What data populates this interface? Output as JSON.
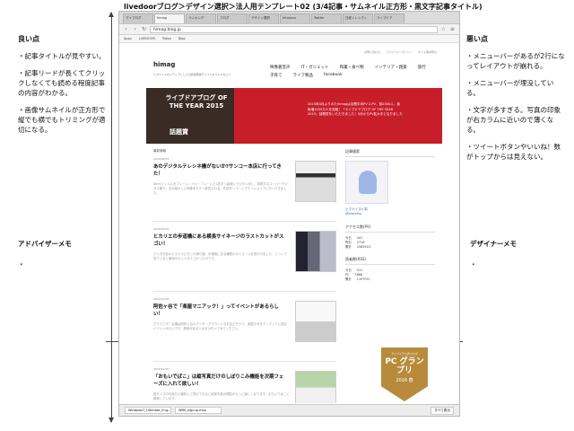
{
  "page_title": "livedoorブログ＞デザイン選択＞法人用テンプレート02 (3/4記事・サムネイル正方形・黒文字記事タイトル)",
  "left_notes": {
    "heading": "良い点",
    "items": [
      "・記事タイトルが見やすい。",
      "・記事リードが長くてクリックしなくても読める程度記事の内容がわかる。",
      "・画像サムネイルが正方形で縦でも横でもトリミングが適切になる。"
    ]
  },
  "right_notes": {
    "heading": "悪い点",
    "items": [
      "・メニューバーがあるが2行になってレイアウトが崩れる。",
      "・メニューバーが埋没している。",
      "・文字が多すぎる。写真の印象が右カラムに近いので薄くなる。",
      "・ツイートボタンやいいね！数がトップからは見えない。"
    ]
  },
  "advisor_memo": {
    "label": "アドバイザーメモ",
    "value": "・"
  },
  "designer_memo": {
    "label": "デザイナーメモ",
    "value": "・"
  },
  "browser": {
    "tabs": [
      "マイブログ",
      "himag",
      "ランキング",
      "ブログ",
      "デザイン選択",
      "hitoanzu",
      "Twitter",
      "日経トレンディ",
      "ライブドア"
    ],
    "url": "himag.blog.jp",
    "bookmarks": [
      "Apps",
      "LIVEDOOR",
      "Tokyo",
      "Blog"
    ]
  },
  "site": {
    "logo": "himag",
    "tagline": "ヒマナイヌのメディアとしての情報発信ライフスタイルマガジン",
    "top_links": [
      "お問い合わせ",
      "プライバシーポリシー",
      "ゲスト取材申込"
    ],
    "nav": [
      "映像著音声",
      "IT・ガジェット",
      "和菓・食べ物",
      "インテリア・雑貨",
      "旅行",
      "子育て",
      "ライフ製品",
      "facebook"
    ],
    "banner": {
      "title": "ライブドアブログ OF THE YEAR 2015",
      "award": "話題賞",
      "text": "2015年4月よりのたhimagは月間平均PV 2,PV、前2000人、前後増1025万人を突破！「ライブドアブログ OF THE YEAR 2015」話題賞をいただきました！3月からPV拡大中となりました"
    },
    "section_label": "最新情報",
    "articles": [
      {
        "date": "2016/02/03",
        "title": "あのデジタルテレシネ機がないか?サンコー本店に行ってきた！",
        "excerpt": "8mmフィルムをフレーム・バイ・フレームで1枚ずつ高速にデジタル化し、再現するスーパーデジタル機で、あの懐かしい映像をもう一度見られる。先週サンコーレアモノショップに行ってきました。"
      },
      {
        "date": "2016/02/01",
        "title": "ヒカリエの歩道橋にある横長サイネージのラストカットがスゴい！",
        "excerpt": "さっき渋谷のヒカリエに行った帰り道、歩道橋にある横長のサイネージを見かけました。じっくり見ていると最後のカットがスゴかったのです。"
      },
      {
        "date": "2016/01/28",
        "title": "阿佐ヶ谷で「楽屋マニアック！」ってイベントがあるらしい！",
        "excerpt": "だそうです！会場は阿佐ヶ谷のアンダーグラウンドなお店だそうで、楽屋ネタをマニアックに語るイベントみたいです。興味がある人はぜひ行ってみてください。"
      },
      {
        "date": "2016/01/25",
        "title": "「おもいでばこ」は縦写真だけのしぼりこみ機能を次期フェーズに入れて欲しい！",
        "excerpt": "縦サイズの写真だけ選択して表示できると家族写真の閲覧がもっと楽しくなります。おもいでばこに期待しています。"
      }
    ],
    "pc_badge": {
      "small": "ライブドア公式ブログ",
      "big": "PC グランプリ",
      "year": "2016 春"
    },
    "sidebar": {
      "heading": "記事検索",
      "profile_name": "ヒマナイヌ川井",
      "profile_id": "@himainu",
      "access_heading": "アクセス数(PV)",
      "access_rows": [
        [
          "今日",
          "441"
        ],
        [
          "昨日",
          "2716"
        ],
        [
          "累計",
          "2585924"
        ]
      ],
      "reader_heading": "読者数(RSS)",
      "reader_rows": [
        [
          "今日",
          "411"
        ],
        [
          "PC",
          "7868"
        ],
        [
          "累計",
          "1197FSC"
        ]
      ]
    }
  },
  "statusbar": {
    "downloads": [
      "Windows7_Ultimate_Eng...rar",
      "WBS_signup.mov"
    ],
    "show_all": "すべて表示"
  }
}
